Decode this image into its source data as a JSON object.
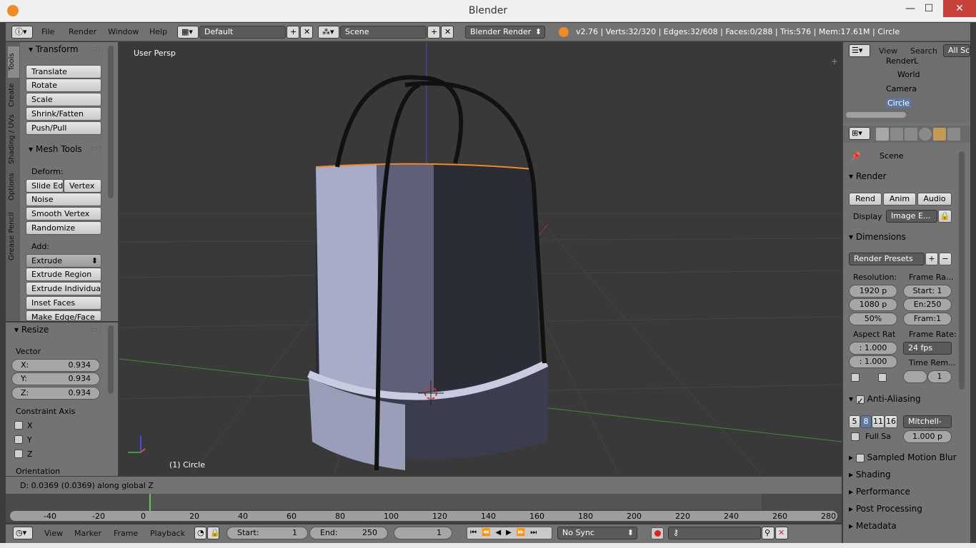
{
  "window": {
    "title": "Blender"
  },
  "info": {
    "menus": [
      "File",
      "Render",
      "Window",
      "Help"
    ],
    "layout": "Default",
    "scene": "Scene",
    "engine": "Blender Render",
    "stats": "v2.76 | Verts:32/320 | Edges:32/608 | Faces:0/288 | Tris:576 | Mem:17.61M | Circle"
  },
  "toolshelf": {
    "tabs": [
      "Tools",
      "Create",
      "Shading / UVs",
      "Options",
      "Grease Pencil"
    ],
    "transform": {
      "title": "Transform",
      "buttons": [
        "Translate",
        "Rotate",
        "Scale",
        "Shrink/Fatten",
        "Push/Pull"
      ]
    },
    "mesh_tools": {
      "title": "Mesh Tools",
      "deform_label": "Deform:",
      "slide_edge": "Slide Ed",
      "vertex": "Vertex",
      "deform_buttons": [
        "Noise",
        "Smooth Vertex",
        "Randomize"
      ],
      "add_label": "Add:",
      "extrude": "Extrude",
      "add_buttons": [
        "Extrude Region",
        "Extrude Individual",
        "Inset Faces",
        "Make Edge/Face"
      ]
    }
  },
  "redo": {
    "title": "Resize",
    "vector_label": "Vector",
    "vector": [
      {
        "axis": "X:",
        "value": "0.934"
      },
      {
        "axis": "Y:",
        "value": "0.934"
      },
      {
        "axis": "Z:",
        "value": "0.934"
      }
    ],
    "constraint_label": "Constraint Axis",
    "constraint": [
      "X",
      "Y",
      "Z"
    ],
    "orientation_label": "Orientation"
  },
  "viewport": {
    "view_name": "User Persp",
    "object_label": "(1) Circle"
  },
  "status": "D: 0.0369 (0.0369) along global Z",
  "timeline": {
    "ticks": [
      "-40",
      "-20",
      "0",
      "20",
      "40",
      "60",
      "80",
      "100",
      "120",
      "140",
      "160",
      "180",
      "200",
      "220",
      "240",
      "260",
      "280"
    ],
    "menus": [
      "View",
      "Marker",
      "Frame",
      "Playback"
    ],
    "start_label": "Start:",
    "start": "1",
    "end_label": "End:",
    "end": "250",
    "current": "1",
    "sync": "No Sync"
  },
  "outliner": {
    "menus": [
      "View",
      "Search"
    ],
    "filter": "All Sc",
    "items": [
      "RenderL",
      "World",
      "Camera",
      "Circle"
    ]
  },
  "properties": {
    "context": "Scene",
    "render": {
      "title": "Render",
      "render_btn": "Rend",
      "anim_btn": "Anim",
      "audio_btn": "Audio",
      "display_label": "Display",
      "display_value": "Image E..."
    },
    "dimensions": {
      "title": "Dimensions",
      "presets": "Render Presets",
      "resolution_label": "Resolution:",
      "res_x": "1920 p",
      "res_y": "1080 p",
      "res_pct": "50%",
      "frame_range_label": "Frame Ra...",
      "start": "Start: 1",
      "end": "En:250",
      "frame": "Fram:1",
      "aspect_label": "Aspect Rat",
      "aspect_x": ": 1.000",
      "aspect_y": ": 1.000",
      "frame_rate_label": "Frame Rate:",
      "fps": "24 fps",
      "time_remap_label": "Time Rem...",
      "time_remap_value": "1"
    },
    "anti_aliasing": {
      "title": "Anti-Aliasing",
      "samples": [
        "5",
        "8",
        "11",
        "16"
      ],
      "filter": "Mitchell-",
      "full_sample": "Full Sa",
      "size": "1.000 p"
    },
    "collapsed": [
      "Sampled Motion Blur",
      "Shading",
      "Performance",
      "Post Processing",
      "Metadata"
    ]
  }
}
